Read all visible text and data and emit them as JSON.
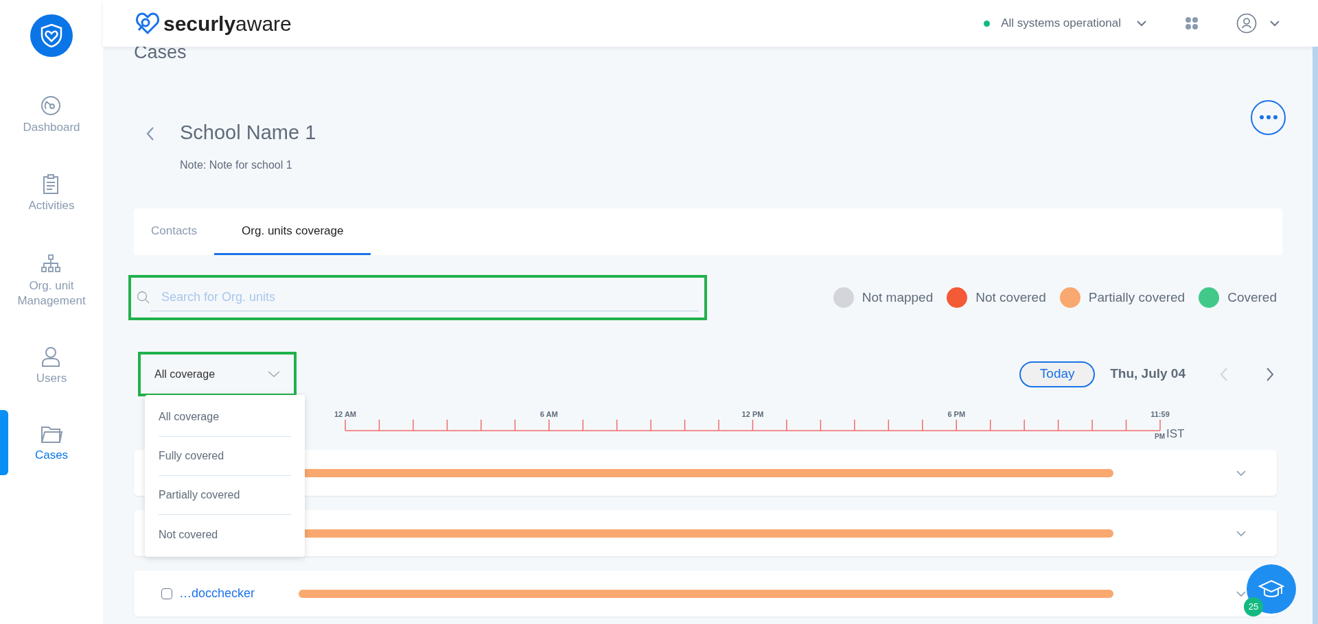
{
  "sidebar": {
    "items": [
      {
        "label": "Dashboard",
        "selected": false
      },
      {
        "label": "Activities",
        "selected": false
      },
      {
        "label": "Org. unit Management",
        "selected": false
      },
      {
        "label": "Users",
        "selected": false
      },
      {
        "label": "Cases",
        "selected": true
      }
    ]
  },
  "header": {
    "brand_bold": "securly",
    "brand_light": "aware",
    "status": {
      "text": "All systems operational",
      "color": "#13b980"
    }
  },
  "page_title": "Cases",
  "school": {
    "name": "School Name 1",
    "note": "Note: Note for school 1"
  },
  "tabs": [
    {
      "label": "Contacts",
      "selected": false
    },
    {
      "label": "Org. units coverage",
      "selected": true
    }
  ],
  "search": {
    "placeholder": "Search for Org. units",
    "highlighted": true
  },
  "legend": [
    {
      "label": "Not mapped",
      "color": "#d4d5da"
    },
    {
      "label": "Not covered",
      "color": "#f35a35"
    },
    {
      "label": "Partially covered",
      "color": "#f9a86f"
    },
    {
      "label": "Covered",
      "color": "#42c98a"
    }
  ],
  "filter": {
    "value": "All coverage",
    "highlighted": true,
    "expanded": true,
    "options": [
      "All coverage",
      "Fully covered",
      "Partially covered",
      "Not covered"
    ]
  },
  "date_nav": {
    "today": "Today",
    "date": "Thu, July 04"
  },
  "timeline": {
    "labels": [
      "12 AM",
      "6 AM",
      "12 PM",
      "6 PM",
      "11:59"
    ],
    "end_meridiem": "PM",
    "timezone": "IST"
  },
  "rows": [
    {
      "color": "#f9a86f"
    },
    {
      "color": "#f9a86f"
    },
    {
      "name": "…docchecker",
      "checked": false,
      "color": "#f9a86f"
    }
  ],
  "help": {
    "badge": "25"
  }
}
